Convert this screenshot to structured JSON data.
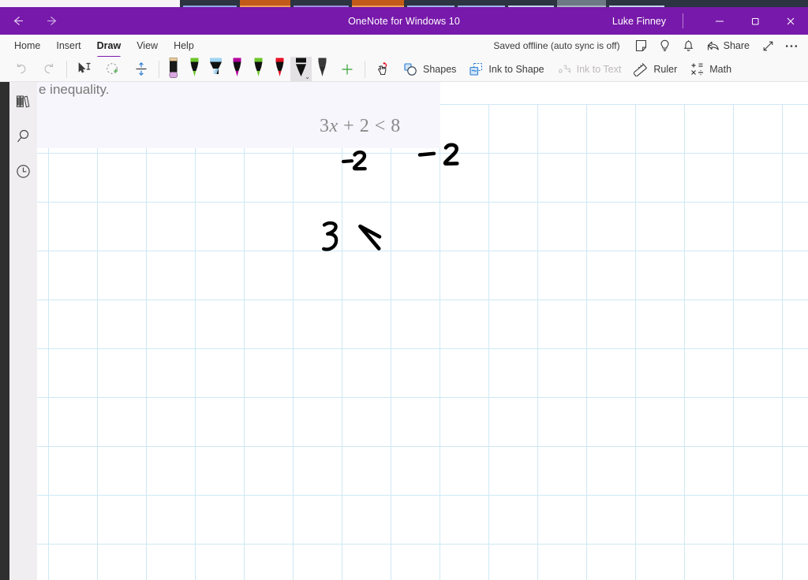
{
  "window": {
    "title": "OneNote for Windows 10",
    "account_name": "Luke Finney",
    "back_icon": "arrow-left-icon",
    "forward_icon": "arrow-right-icon",
    "minimize_label": "–",
    "maximize_icon": "restore-icon",
    "close_icon": "close-icon",
    "accent_color": "#7719aa"
  },
  "ribbon": {
    "tabs": [
      {
        "label": "Home",
        "active": false
      },
      {
        "label": "Insert",
        "active": false
      },
      {
        "label": "Draw",
        "active": true
      },
      {
        "label": "View",
        "active": false
      },
      {
        "label": "Help",
        "active": false
      }
    ],
    "save_status": "Saved offline (auto sync is off)",
    "right_icons": [
      {
        "name": "sticky-note-icon"
      },
      {
        "name": "lightbulb-icon"
      },
      {
        "name": "bell-notification-icon"
      }
    ],
    "share_label": "Share",
    "expand_icon": "expand-diagonal-icon",
    "more_icon": "ellipsis-icon"
  },
  "draw_toolbar": {
    "undo_label": "Undo",
    "redo_label": "Redo",
    "select_label": "Lasso Select",
    "add_space_label": "Insert Space",
    "pens": [
      {
        "name": "eraser",
        "tip": "#e2c79a",
        "body": "#1a1a1a",
        "bottom": "#d9a8e0",
        "type": "eraser",
        "selected": false
      },
      {
        "name": "pen-green",
        "tip": "#6bc72b",
        "body": "#1a1a1a",
        "type": "pen",
        "selected": false
      },
      {
        "name": "highlighter-blue",
        "tip": "#9fd4f2",
        "body": "#1a1a1a",
        "type": "highlighter",
        "selected": false
      },
      {
        "name": "pen-magenta",
        "tip": "#b4009e",
        "body": "#1a1a1a",
        "type": "pen",
        "selected": false
      },
      {
        "name": "pen-green-2",
        "tip": "#6bc72b",
        "body": "#1a1a1a",
        "type": "pen",
        "selected": false
      },
      {
        "name": "pen-red",
        "tip": "#e81123",
        "body": "#1a1a1a",
        "type": "pen",
        "selected": false
      },
      {
        "name": "pen-black",
        "tip": "#1a1a1a",
        "body": "#1a1a1a",
        "type": "pen",
        "selected": true
      },
      {
        "name": "pen-dark-grey",
        "tip": "#3a3a3a",
        "body": "#3a3a3a",
        "type": "pen",
        "selected": false
      }
    ],
    "add_pen_label": "+",
    "ink_gesture_label": "Ink Gestures",
    "shapes_label": "Shapes",
    "ink_to_shape_label": "Ink to Shape",
    "ink_to_text_label": "Ink to Text",
    "ink_to_text_disabled": true,
    "ruler_label": "Ruler",
    "math_label": "Math"
  },
  "navrail": {
    "items": [
      {
        "name": "notebooks-icon",
        "label": "Notebooks"
      },
      {
        "name": "search-icon",
        "label": "Search"
      },
      {
        "name": "recent-notes-icon",
        "label": "Recent Notes"
      }
    ]
  },
  "page": {
    "heading_text": "e inequality.",
    "equation_prefix": "3",
    "equation_var": "x",
    "equation_suffix": " + 2 < 8",
    "ink_annotations": [
      {
        "name": "ink-minus-two-left",
        "text": "-2"
      },
      {
        "name": "ink-minus-two-right",
        "text": "– 2"
      },
      {
        "name": "ink-three",
        "text": "3"
      },
      {
        "name": "ink-less-than",
        "text": "<"
      }
    ],
    "grid_color": "#cfe8f5",
    "textbox_color": "#f7f6fc",
    "ink_color": "#000000"
  }
}
